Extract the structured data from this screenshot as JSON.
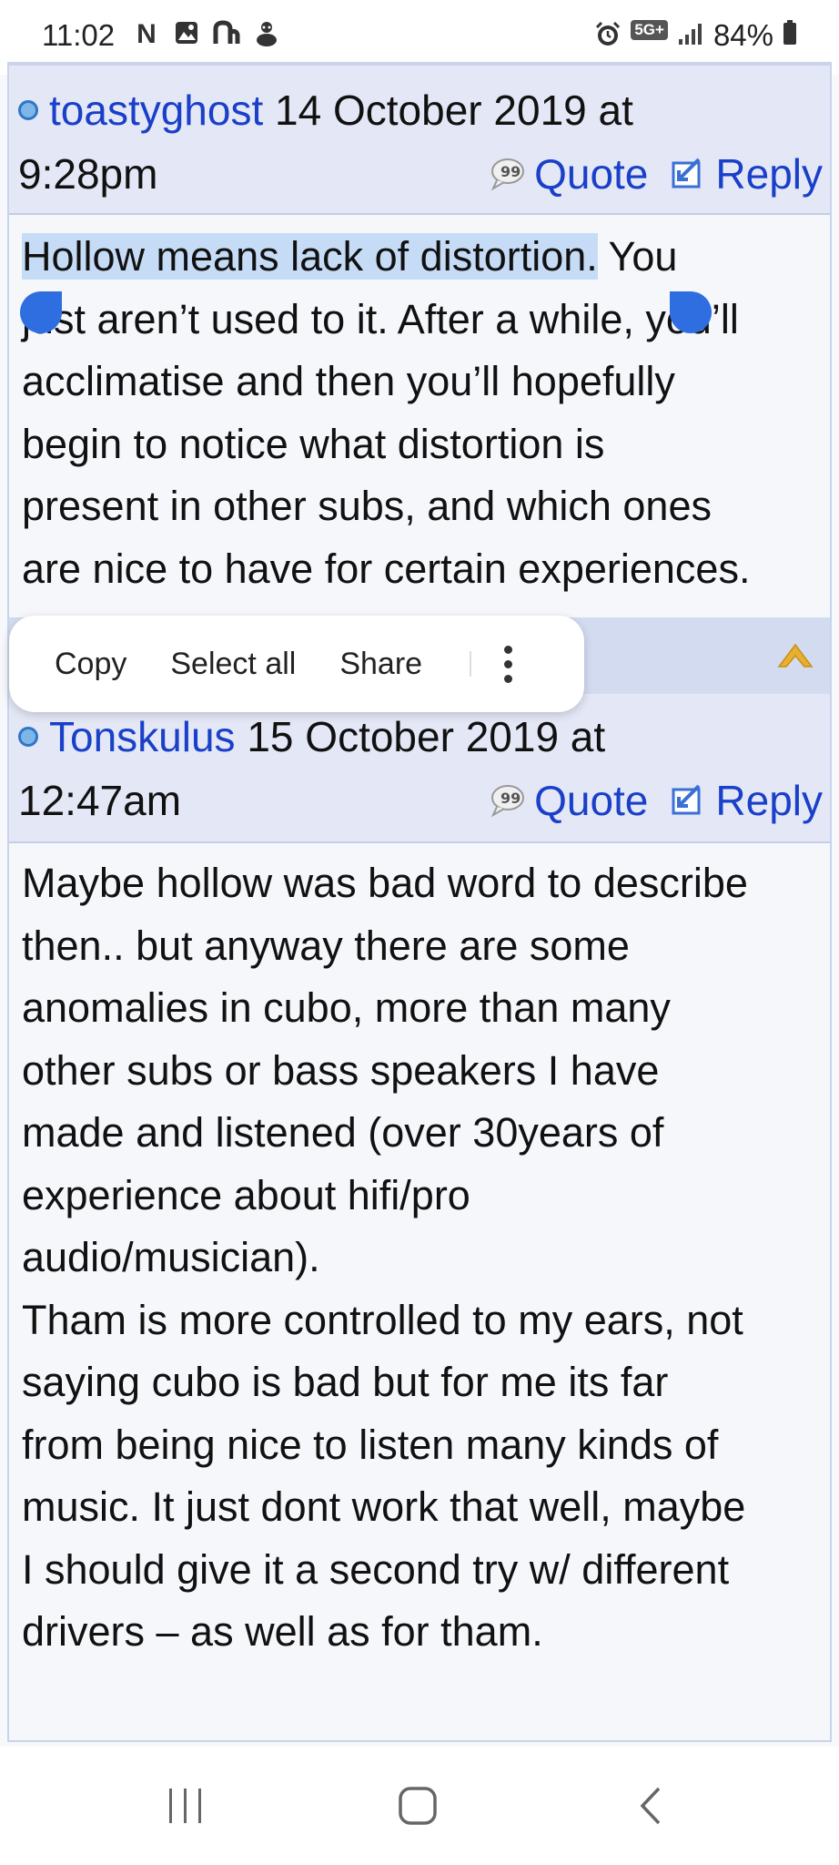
{
  "status_bar": {
    "time": "11:02",
    "left_icons": [
      "netflix-icon",
      "gallery-icon",
      "app-n-icon",
      "sticker-icon"
    ],
    "right_icons": [
      "alarm-icon",
      "5g-plus-icon",
      "signal-icon"
    ],
    "network": "5G+",
    "battery": "84%"
  },
  "posts": [
    {
      "author": "toastyghost",
      "date_part1": "14 October 2019 at",
      "date_part2": "9:28pm",
      "quote_label": "Quote",
      "reply_label": "Reply",
      "selected_text": "Hollow means lack of distortion.",
      "body_rest_line1": " You",
      "body_lines": [
        "just aren’t used to it. After a while, you’ll",
        "acclimatise and then you’ll hopefully",
        "begin to notice what distortion is",
        "present in other subs, and which ones",
        "are nice to have for certain experiences."
      ]
    },
    {
      "author": "Tonskulus",
      "date_part1": "15 October 2019 at",
      "date_part2": "12:47am",
      "quote_label": "Quote",
      "reply_label": "Reply",
      "body_lines": [
        "Maybe hollow was bad word to describe",
        "then.. but anyway there are some",
        "anomalies in cubo, more than many",
        "other subs or bass speakers I have",
        "made and listened (over 30years of",
        "experience about hifi/pro",
        "audio/musician).",
        "Tham is more controlled to my ears, not",
        "saying cubo is bad but for me its far",
        "from being nice to listen many kinds of",
        "music. It just dont work that well, maybe",
        "I should give it a second try w/ different",
        "drivers – as well as for tham."
      ]
    }
  ],
  "context_menu": {
    "copy": "Copy",
    "select_all": "Select all",
    "share": "Share"
  },
  "nav_bar": {
    "buttons": [
      "recent-apps-icon",
      "home-icon",
      "back-icon"
    ]
  },
  "colors": {
    "link": "#1a3fc8",
    "header_bg": "#e4e8f6",
    "selection": "#c6dcf6",
    "handle": "#2f6ee0"
  }
}
